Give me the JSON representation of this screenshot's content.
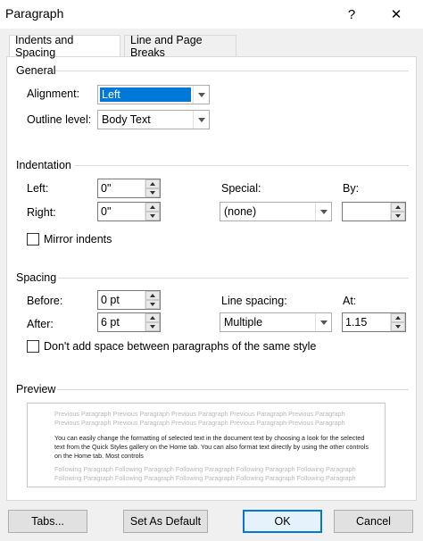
{
  "window": {
    "title": "Paragraph",
    "help": "?",
    "close": "✕"
  },
  "tabs": [
    {
      "label": "Indents and Spacing",
      "active": true
    },
    {
      "label": "Line and Page Breaks",
      "active": false
    }
  ],
  "general": {
    "title": "General",
    "alignment": {
      "label": "Alignment:",
      "value": "Left"
    },
    "outline_level": {
      "label": "Outline level:",
      "value": "Body Text"
    }
  },
  "indentation": {
    "title": "Indentation",
    "left": {
      "label": "Left:",
      "value": "0\""
    },
    "right": {
      "label": "Right:",
      "value": "0\""
    },
    "special": {
      "label": "Special:",
      "value": "(none)"
    },
    "by": {
      "label": "By:",
      "value": ""
    },
    "mirror": {
      "label": "Mirror indents",
      "checked": false
    }
  },
  "spacing": {
    "title": "Spacing",
    "before": {
      "label": "Before:",
      "value": "0 pt"
    },
    "after": {
      "label": "After:",
      "value": "6 pt"
    },
    "line_spacing": {
      "label": "Line spacing:",
      "value": "Multiple"
    },
    "at": {
      "label": "At:",
      "value": "1.15"
    },
    "dont_add": {
      "label": "Don't add space between paragraphs of the same style",
      "checked": false
    }
  },
  "preview": {
    "title": "Preview",
    "prev_line1": "Previous Paragraph Previous Paragraph Previous Paragraph Previous Paragraph Previous Paragraph",
    "prev_line2": "Previous Paragraph Previous Paragraph Previous Paragraph Previous Paragraph Previous Paragraph",
    "sample_line1": "You can easily change the formatting of selected text in the document text by choosing a look for the selected",
    "sample_line2": "text from the Quick Styles gallery on the Home tab. You can also format text directly by using the other controls",
    "sample_line3": "on the Home tab. Most controls",
    "follow_line1": "Following Paragraph Following Paragraph Following Paragraph Following Paragraph Following Paragraph",
    "follow_line2": "Following Paragraph Following Paragraph Following Paragraph Following Paragraph Following Paragraph"
  },
  "buttons": {
    "tabs": "Tabs...",
    "set_default": "Set As Default",
    "ok": "OK",
    "cancel": "Cancel"
  },
  "colors": {
    "accent": "#0078d7",
    "background": "#f0f0f0"
  }
}
